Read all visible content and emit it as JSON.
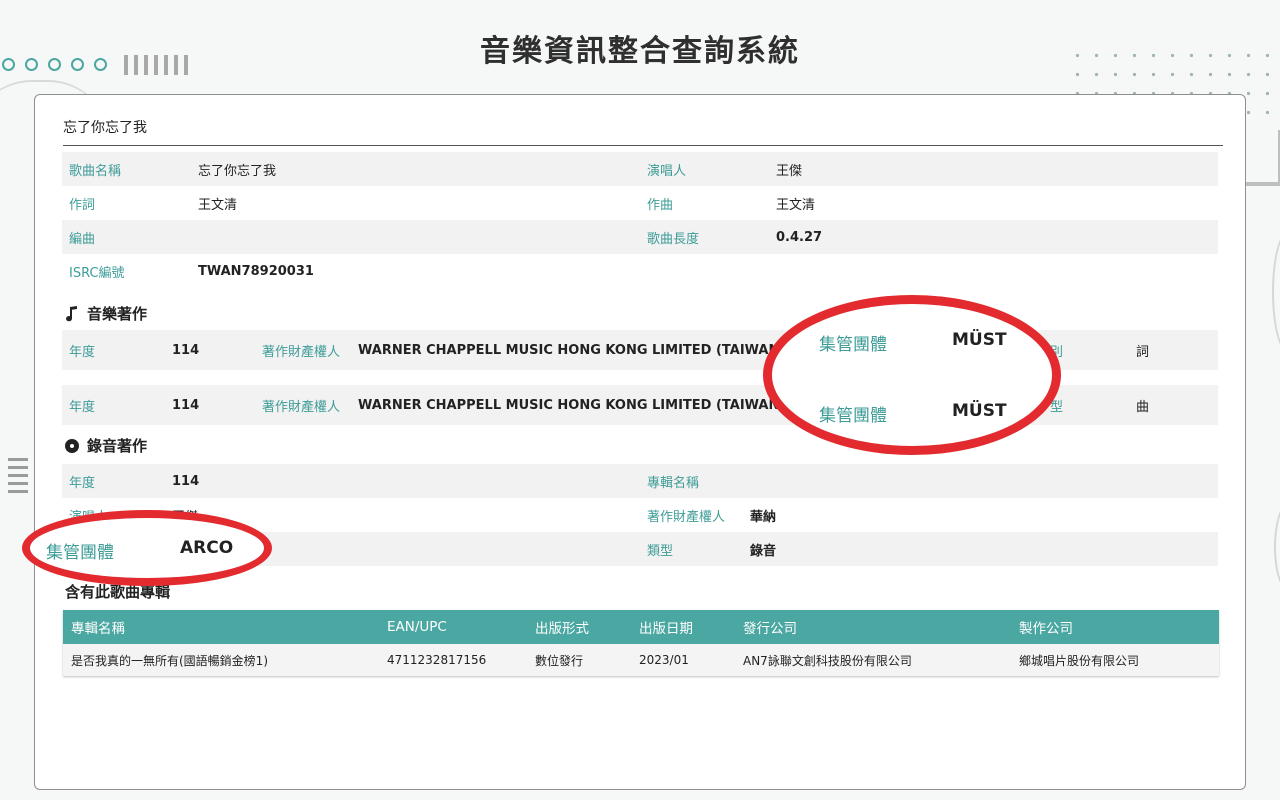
{
  "page": {
    "title": "音樂資訊整合查詢系統"
  },
  "song": {
    "heading": "忘了你忘了我",
    "fields": {
      "song_name": {
        "label": "歌曲名稱",
        "value": "忘了你忘了我"
      },
      "singer": {
        "label": "演唱人",
        "value": "王傑"
      },
      "lyricist": {
        "label": "作詞",
        "value": "王文清"
      },
      "composer": {
        "label": "作曲",
        "value": "王文清"
      },
      "arranger": {
        "label": "編曲",
        "value": ""
      },
      "duration": {
        "label": "歌曲長度",
        "value": "0.4.27"
      },
      "isrc": {
        "label": "ISRC編號",
        "value": "TWAN78920031"
      }
    }
  },
  "music_works": {
    "title": "音樂著作",
    "rows": [
      {
        "year_label": "年度",
        "year": "114",
        "owner_label": "著作財產權人",
        "owner": "WARNER CHAPPELL MUSIC HONG KONG LIMITED (TAIWAN B",
        "ellipsis": "…",
        "type_label_partial": "別",
        "type": "詞"
      },
      {
        "year_label": "年度",
        "year": "114",
        "owner_label": "著作財產權人",
        "owner": "WARNER CHAPPELL MUSIC HONG KONG LIMITED (TAIWAN B",
        "type_label_partial": "型",
        "type": "曲"
      }
    ]
  },
  "recording_works": {
    "title": "錄音著作",
    "year_label": "年度",
    "year": "114",
    "album_label": "專輯名稱",
    "album": "",
    "singer_label_partial": "演唱人",
    "singer_partial": "王傑",
    "owner_label": "著作財產權人",
    "owner": "華納",
    "type_label": "類型",
    "type": "錄音"
  },
  "albums": {
    "title": "含有此歌曲專輯",
    "columns": [
      "專輯名稱",
      "EAN/UPC",
      "出版形式",
      "出版日期",
      "發行公司",
      "製作公司"
    ],
    "rows": [
      [
        "是否我真的一無所有(國語暢銷金榜1)",
        "4711232817156",
        "數位發行",
        "2023/01",
        "AN7詠聯文創科技股份有限公司",
        "鄉城唱片股份有限公司"
      ]
    ]
  },
  "highlights": {
    "must_label": "集管團體",
    "must_value": "MÜST",
    "arco_label": "集管團體",
    "arco_value": "ARCO",
    "accent_color": "#e32b2f"
  },
  "colors": {
    "teal": "#4aa7a2",
    "label": "#3e9c98"
  }
}
